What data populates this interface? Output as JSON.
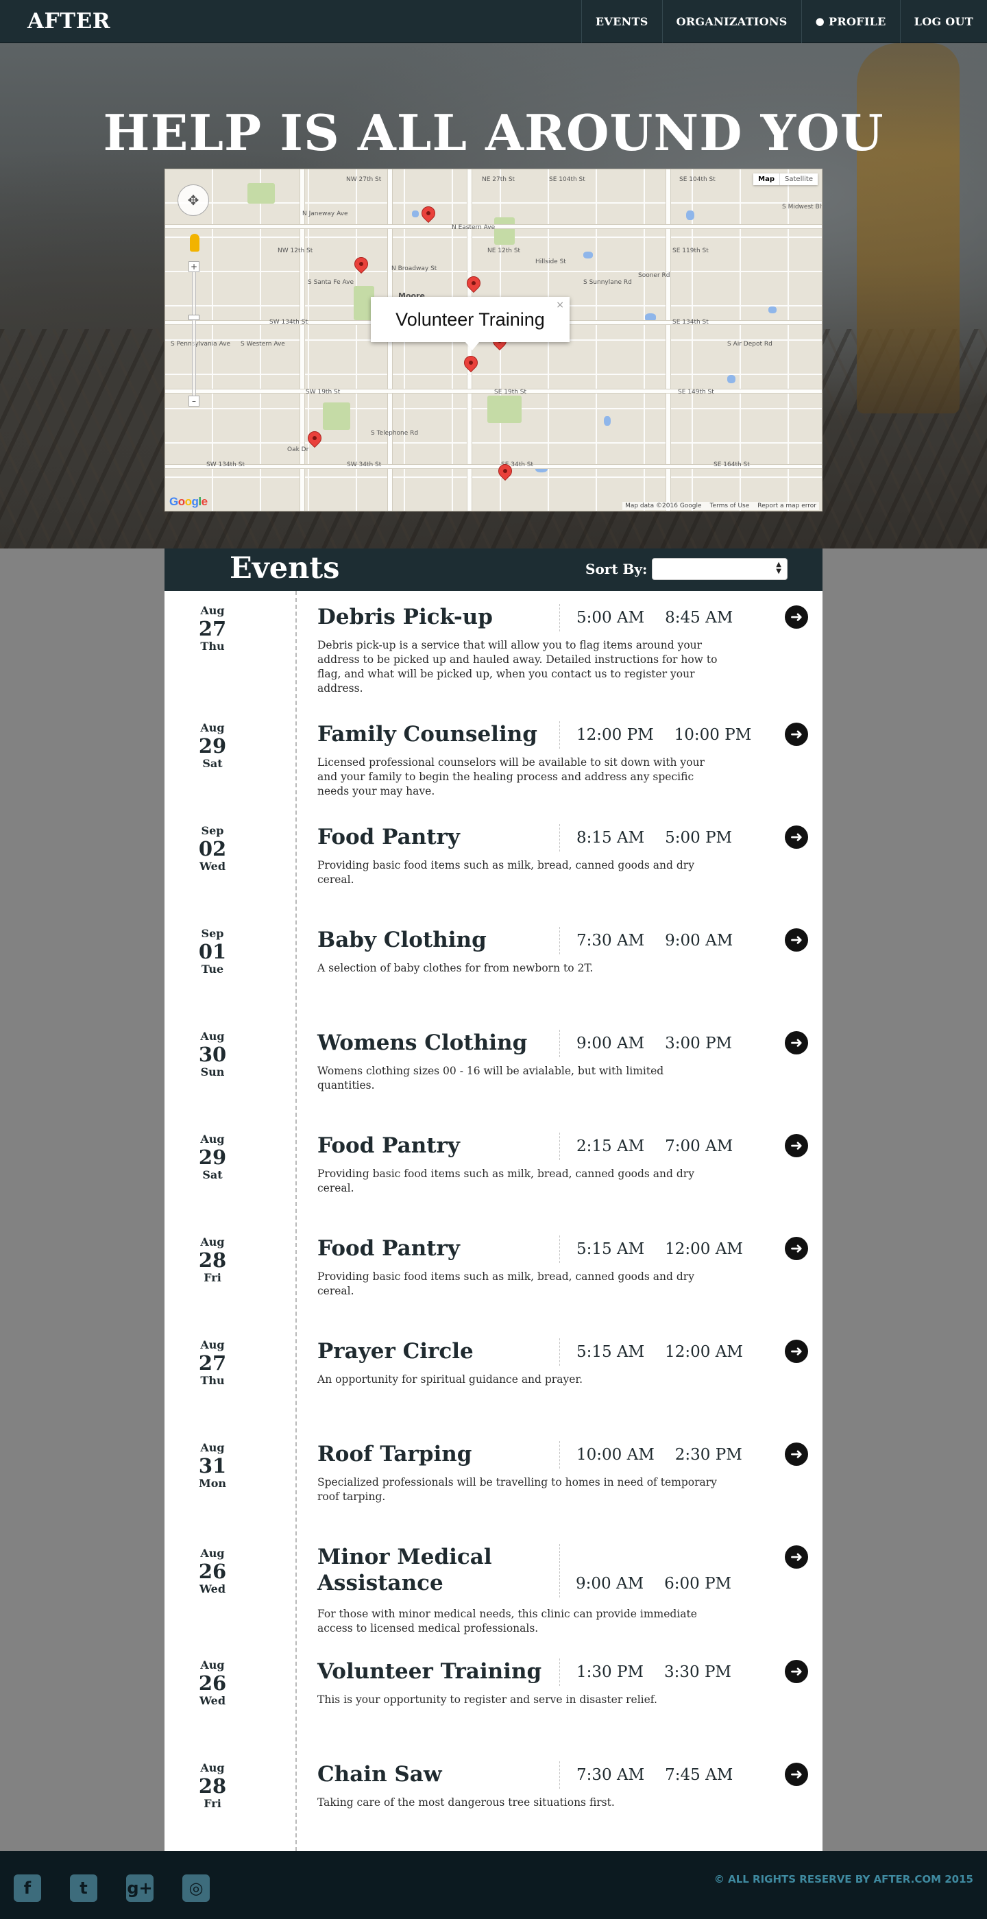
{
  "nav": {
    "brand": "AFTER",
    "links": [
      {
        "label": "EVENTS",
        "icon": ""
      },
      {
        "label": "ORGANIZATIONS",
        "icon": ""
      },
      {
        "label": "PROFILE",
        "icon": "user-icon"
      },
      {
        "label": "LOG OUT",
        "icon": ""
      }
    ]
  },
  "hero": {
    "title": "HELP IS ALL AROUND YOU"
  },
  "map": {
    "map_types": [
      "Map",
      "Satellite"
    ],
    "selected_type": "Map",
    "info_window_title": "Volunteer Training",
    "streets": [
      "NW 27th St",
      "NE 27th St",
      "SE 104th St",
      "SE 104th St",
      "NW 12th St",
      "NE 12th St",
      "SE 119th St",
      "SW 134th St",
      "SE 134th St",
      "SW 19th St",
      "SE 19th St",
      "SE 149th St",
      "SW 134th St",
      "SW 34th St",
      "SE 34th St",
      "SE 164th St",
      "Moore",
      "S Telephone Rd",
      "N Broadway St",
      "N Eastern Ave",
      "S Sunnylane Rd",
      "S Western Ave",
      "S Pennsylvania Ave",
      "S Santa Fe Ave",
      "Hillside St",
      "N Janeway Ave",
      "Sooner Rd",
      "S Air Depot Rd",
      "S Midwest Blvd",
      "Oak Dr"
    ],
    "footer": [
      "Map data ©2016 Google",
      "Terms of Use",
      "Report a map error"
    ],
    "logo": "Google"
  },
  "events_header": {
    "title": "Events",
    "sort_label": "Sort By:",
    "sort_value": ""
  },
  "events": [
    {
      "month": "Aug",
      "day": "27",
      "weekday": "Thu",
      "title": "Debris Pick-up",
      "start": "5:00 AM",
      "end": "8:45 AM",
      "description": "Debris pick-up is a service that will allow you to flag items around your address to be picked up and hauled away. Detailed instructions for how to flag, and what will be picked up, when you contact us to register your address."
    },
    {
      "month": "Aug",
      "day": "29",
      "weekday": "Sat",
      "title": "Family Counseling",
      "start": "12:00 PM",
      "end": "10:00 PM",
      "description": "Licensed professional counselors will be available to sit down with your and your family to begin the healing process and address any specific needs your may have."
    },
    {
      "month": "Sep",
      "day": "02",
      "weekday": "Wed",
      "title": "Food Pantry",
      "start": "8:15 AM",
      "end": "5:00 PM",
      "description": "Providing basic food items such as milk, bread, canned goods and dry cereal."
    },
    {
      "month": "Sep",
      "day": "01",
      "weekday": "Tue",
      "title": "Baby Clothing",
      "start": "7:30 AM",
      "end": "9:00 AM",
      "description": "A selection of baby clothes for from newborn to 2T."
    },
    {
      "month": "Aug",
      "day": "30",
      "weekday": "Sun",
      "title": "Womens Clothing",
      "start": "9:00 AM",
      "end": "3:00 PM",
      "description": "Womens clothing sizes 00 - 16 will be avialable, but with limited quantities."
    },
    {
      "month": "Aug",
      "day": "29",
      "weekday": "Sat",
      "title": "Food Pantry",
      "start": "2:15 AM",
      "end": "7:00 AM",
      "description": "Providing basic food items such as milk, bread, canned goods and dry cereal."
    },
    {
      "month": "Aug",
      "day": "28",
      "weekday": "Fri",
      "title": "Food Pantry",
      "start": "5:15 AM",
      "end": "12:00 AM",
      "description": "Providing basic food items such as milk, bread, canned goods and dry cereal."
    },
    {
      "month": "Aug",
      "day": "27",
      "weekday": "Thu",
      "title": "Prayer Circle",
      "start": "5:15 AM",
      "end": "12:00 AM",
      "description": "An opportunity for spiritual guidance and prayer."
    },
    {
      "month": "Aug",
      "day": "31",
      "weekday": "Mon",
      "title": "Roof Tarping",
      "start": "10:00 AM",
      "end": "2:30 PM",
      "description": "Specialized professionals will be travelling to homes in need of temporary roof tarping."
    },
    {
      "month": "Aug",
      "day": "26",
      "weekday": "Wed",
      "title": "Minor Medical Assistance",
      "start": "9:00 AM",
      "end": "6:00 PM",
      "description": "For those with minor medical needs, this clinic can provide immediate access to licensed medical professionals."
    },
    {
      "month": "Aug",
      "day": "26",
      "weekday": "Wed",
      "title": "Volunteer Training",
      "start": "1:30 PM",
      "end": "3:30 PM",
      "description": "This is your opportunity to register and serve in disaster relief."
    },
    {
      "month": "Aug",
      "day": "28",
      "weekday": "Fri",
      "title": "Chain Saw",
      "start": "7:30 AM",
      "end": "7:45 AM",
      "description": "Taking care of the most dangerous tree situations first."
    }
  ],
  "footer": {
    "social": [
      "facebook-icon",
      "twitter-icon",
      "google-plus-icon",
      "instagram-icon"
    ],
    "copyright": "© ALL RIGHTS RESERVE BY AFTER.COM 2015"
  }
}
